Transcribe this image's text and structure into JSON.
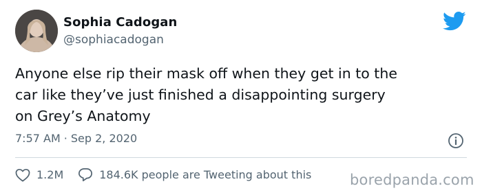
{
  "author": {
    "name": "Sophia Cadogan",
    "handle": "@sophiacadogan"
  },
  "icons": {
    "brand": "twitter-bird-icon",
    "info": "info-icon",
    "like": "heart-icon",
    "reply": "speech-bubble-icon"
  },
  "colors": {
    "twitter_blue": "#1d9bf0",
    "secondary_text": "#536471"
  },
  "tweet": {
    "text": "Anyone else rip their mask off when they get in to the\ncar like they’ve just finished a disappointing surgery\non Grey’s Anatomy",
    "time": "7:57 AM",
    "separator": "·",
    "date": "Sep 2, 2020"
  },
  "actions": {
    "likes": "1.2M",
    "conversation": "184.6K people are Tweeting about this"
  },
  "watermark": "boredpanda.com"
}
